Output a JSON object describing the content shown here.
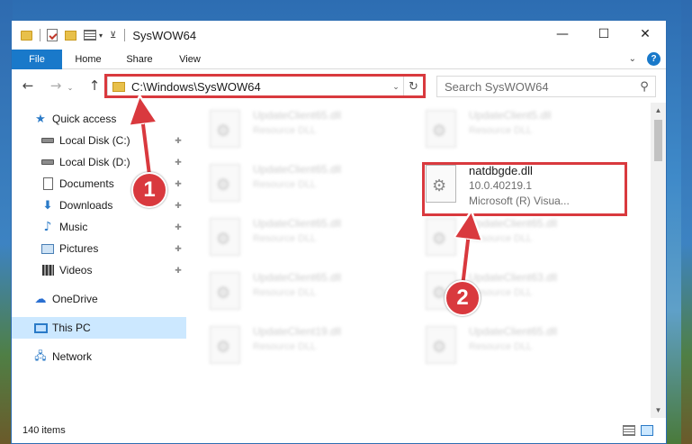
{
  "window": {
    "title": "SysWOW64",
    "minimize": "—",
    "maximize": "☐",
    "close": "✕"
  },
  "ribbon": {
    "tabs": [
      "File",
      "Home",
      "Share",
      "View"
    ],
    "expand_glyph": "⌄",
    "help": "?"
  },
  "nav": {
    "back": "←",
    "forward": "→",
    "recent": "⌄",
    "up": "↑",
    "address": "C:\\Windows\\SysWOW64",
    "address_dropdown": "⌄",
    "refresh": "↻",
    "search_placeholder": "Search SysWOW64",
    "search_glyph": "⚲"
  },
  "sidebar": {
    "items": [
      {
        "label": "Quick access",
        "icon": "star-icon",
        "pinned": false
      },
      {
        "label": "Local Disk (C:)",
        "icon": "disk-icon",
        "pinned": true
      },
      {
        "label": "Local Disk (D:)",
        "icon": "disk-icon",
        "pinned": true
      },
      {
        "label": "Documents",
        "icon": "document-icon",
        "pinned": true
      },
      {
        "label": "Downloads",
        "icon": "download-icon",
        "pinned": true
      },
      {
        "label": "Music",
        "icon": "music-icon",
        "pinned": true
      },
      {
        "label": "Pictures",
        "icon": "pictures-icon",
        "pinned": true
      },
      {
        "label": "Videos",
        "icon": "video-icon",
        "pinned": true
      },
      {
        "label": "OneDrive",
        "icon": "cloud-icon",
        "pinned": false
      },
      {
        "label": "This PC",
        "icon": "computer-icon",
        "pinned": false,
        "selected": true
      },
      {
        "label": "Network",
        "icon": "network-icon",
        "pinned": false
      }
    ],
    "pin_glyph": "📌"
  },
  "files": {
    "left_column": [
      {
        "name": "UpdateClient65.dll",
        "type": "Resource DLL"
      },
      {
        "name": "UpdateClient65.dll",
        "type": "Resource DLL"
      },
      {
        "name": "UpdateClient65.dll",
        "type": "Resource DLL"
      },
      {
        "name": "UpdateClient65.dll",
        "type": "Resource DLL"
      },
      {
        "name": "UpdateClient19.dll",
        "type": "Resource DLL"
      }
    ],
    "right_column": [
      {
        "name": "UpdateClient5.dll",
        "type": "Resource DLL"
      },
      {
        "name": "UpdateClient65.dll",
        "type": "Resource DLL"
      },
      {
        "name": "UpdateClient63.dll",
        "type": "Resource DLL"
      },
      {
        "name": "UpdateClient65.dll",
        "type": "Resource DLL"
      }
    ],
    "highlighted": {
      "name": "natdbgde.dll",
      "version": "10.0.40219.1",
      "company": "Microsoft (R) Visua..."
    },
    "icon_glyph": "⚙"
  },
  "status": {
    "count": "140 items"
  },
  "callouts": [
    "1",
    "2"
  ],
  "colors": {
    "accent": "#1979ca",
    "highlight": "#d9393e",
    "selected": "#cce8ff"
  }
}
